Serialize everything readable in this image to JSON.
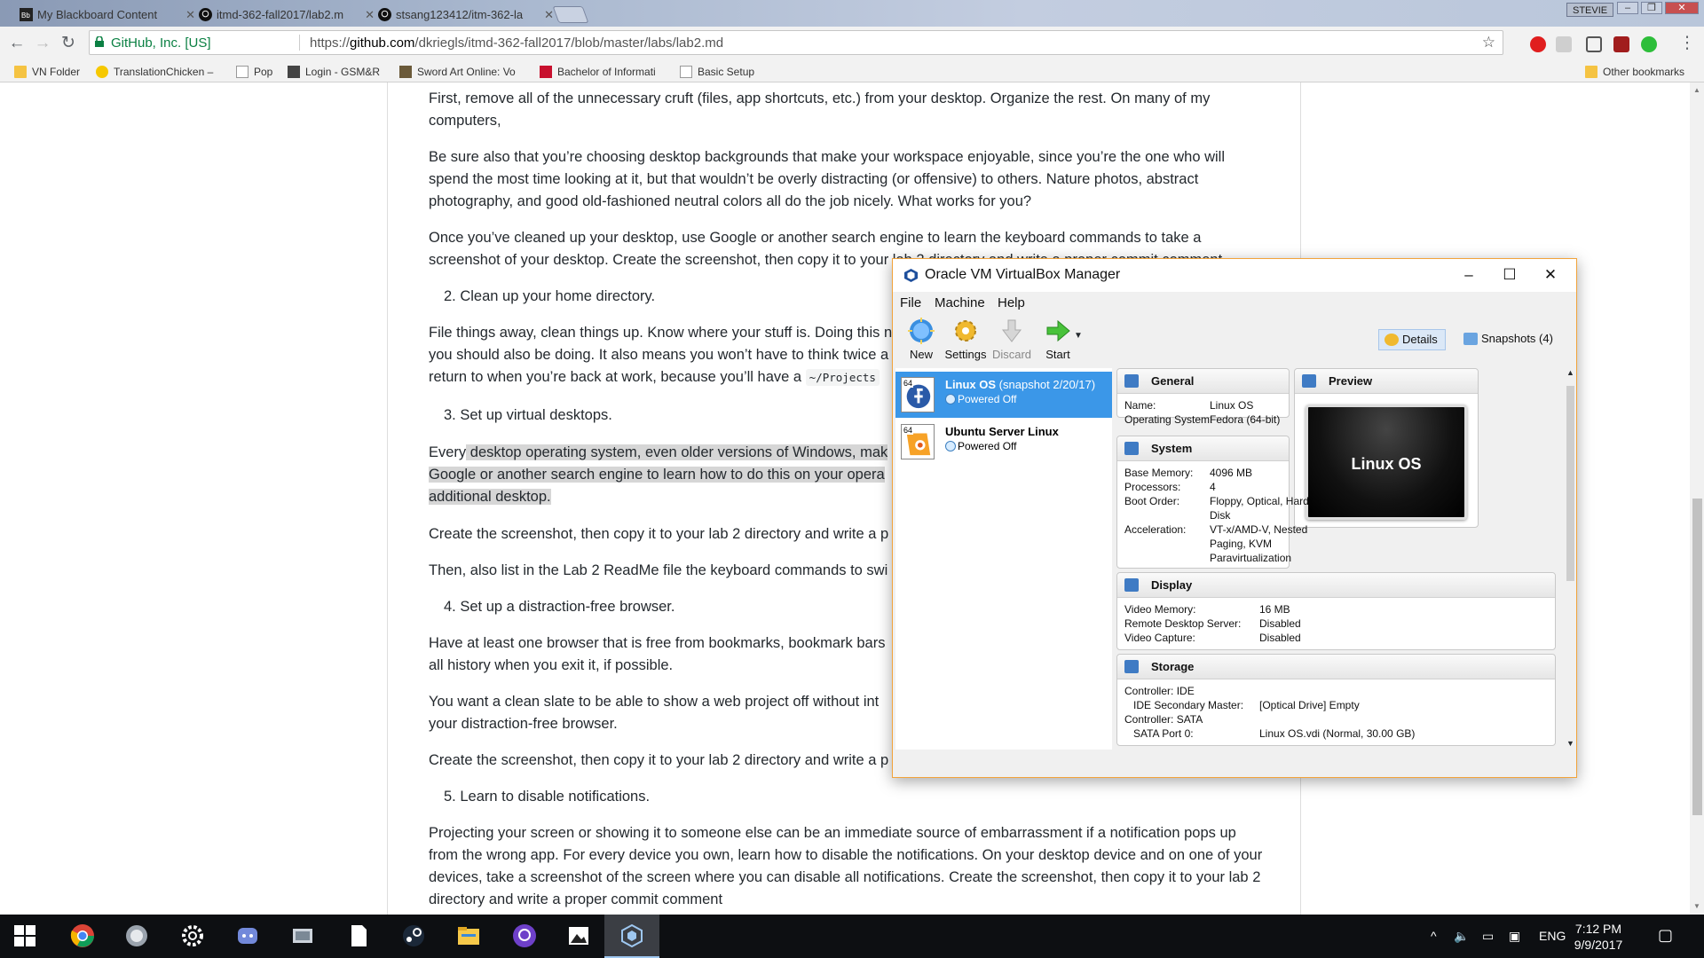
{
  "browser": {
    "tabs": [
      {
        "title": "My Blackboard Content",
        "active": false
      },
      {
        "title": "itmd-362-fall2017/lab2.m",
        "active": true
      },
      {
        "title": "stsang123412/itm-362-la",
        "active": false
      }
    ],
    "user_badge": "STEVIE",
    "site_identity": "GitHub, Inc. [US]",
    "url_prefix": "https://",
    "url_host": "github.com",
    "url_path": "/dkriegls/itmd-362-fall2017/blob/master/labs/lab2.md",
    "bookmarks": [
      {
        "label": "VN Folder",
        "icon": "folder-icon"
      },
      {
        "label": "TranslationChicken –",
        "icon": "chicken-icon"
      },
      {
        "label": "Pop",
        "icon": "page-icon"
      },
      {
        "label": "Login - GSM&R",
        "icon": "login-icon"
      },
      {
        "label": "Sword Art Online: Vo",
        "icon": "sao-icon"
      },
      {
        "label": "Bachelor of Informati",
        "icon": "iit-icon"
      },
      {
        "label": "Basic Setup",
        "icon": "page-icon"
      }
    ],
    "other_bookmarks": "Other bookmarks"
  },
  "doc": {
    "p1": "First, remove all of the unnecessary cruft (files, app shortcuts, etc.) from your desktop. Organize the rest. On many of my computers,",
    "p2": "Be sure also that you’re choosing desktop backgrounds that make your workspace enjoyable, since you’re the one who will spend the most time looking at it, but that wouldn’t be overly distracting (or offensive) to others. Nature photos, abstract photography, and good old-fashioned neutral colors all do the job nicely. What works for you?",
    "p3": "Once you’ve cleaned up your desktop, use Google or another search engine to learn the keyboard commands to take a screenshot of your desktop. Create the screenshot, then copy it to your lab 2 directory and write a proper commit comment.",
    "li2": "2. Clean up your home directory.",
    "p4a": "File things away, clean things up. Know where your stuff is. Doing this n",
    "p4b": "you should also be doing. It also means you won’t have to think twice a",
    "p4c_pre": "return to when you’re back at work, because you’ll have a",
    "p4c_code": "~/Projects",
    "li3": "3. Set up virtual desktops.",
    "p5a_pre": "Every",
    "p5a_hl": " desktop operating system, even older versions of Windows, mak",
    "p5b": "Google or another search engine to learn how to do this on your opera",
    "p5c": "additional desktop.",
    "p6": "Create the screenshot, then copy it to your lab 2 directory and write a p",
    "p7": "Then, also list in the Lab 2 ReadMe file the keyboard commands to swi",
    "li4": "4. Set up a distraction-free browser.",
    "p8a": "Have at least one browser that is free from bookmarks, bookmark bars",
    "p8b": "all history when you exit it, if possible.",
    "p9a": "You want a clean slate to be able to show a web project off without int",
    "p9b": "your distraction-free browser.",
    "p10": "Create the screenshot, then copy it to your lab 2 directory and write a p",
    "li5": "5. Learn to disable notifications.",
    "p11": "Projecting your screen or showing it to someone else can be an immediate source of embarrassment if a notification pops up from the wrong app. For every device you own, learn how to disable the notifications. On your desktop device and on one of your devices, take a screenshot of the screen where you can disable all notifications. Create the screenshot, then copy it to your lab 2 directory and write a proper commit comment"
  },
  "vbox": {
    "title": "Oracle VM VirtualBox Manager",
    "menu": [
      "File",
      "Machine",
      "Help"
    ],
    "tools": [
      {
        "label": "New",
        "icon": "new-icon",
        "enabled": true
      },
      {
        "label": "Settings",
        "icon": "settings-gear-icon",
        "enabled": true
      },
      {
        "label": "Discard",
        "icon": "discard-icon",
        "enabled": false
      },
      {
        "label": "Start",
        "icon": "start-arrow-icon",
        "enabled": true
      }
    ],
    "details_tab": "Details",
    "snapshots_tab": "Snapshots (4)",
    "vms": [
      {
        "name": "Linux OS",
        "snapshot": " (snapshot 2/20/17)",
        "state": "Powered Off",
        "bits": "64",
        "selected": true
      },
      {
        "name": "Ubuntu Server Linux",
        "snapshot": "",
        "state": "Powered Off",
        "bits": "64",
        "selected": false
      }
    ],
    "general": {
      "title": "General",
      "rows": [
        [
          "Name:",
          "Linux OS"
        ],
        [
          "Operating System:",
          "Fedora (64-bit)"
        ]
      ]
    },
    "system": {
      "title": "System",
      "rows": [
        [
          "Base Memory:",
          "4096 MB"
        ],
        [
          "Processors:",
          "4"
        ],
        [
          "Boot Order:",
          "Floppy, Optical, Hard Disk"
        ],
        [
          "Acceleration:",
          "VT-x/AMD-V, Nested Paging, KVM Paravirtualization"
        ]
      ],
      "boot_l1": "Floppy, Optical, Hard",
      "boot_l2": "Disk",
      "acc_l1": "VT-x/AMD-V, Nested",
      "acc_l2": "Paging, KVM",
      "acc_l3": "Paravirtualization"
    },
    "preview": {
      "title": "Preview",
      "screen_text": "Linux OS"
    },
    "display": {
      "title": "Display",
      "rows": [
        [
          "Video Memory:",
          "16 MB"
        ],
        [
          "Remote Desktop Server:",
          "Disabled"
        ],
        [
          "Video Capture:",
          "Disabled"
        ]
      ]
    },
    "storage": {
      "title": "Storage",
      "rows": [
        [
          "Controller: IDE",
          ""
        ],
        [
          "IDE Secondary Master:",
          "[Optical Drive] Empty"
        ],
        [
          "Controller: SATA",
          ""
        ],
        [
          "SATA Port 0:",
          "Linux OS.vdi (Normal, 30.00 GB)"
        ]
      ]
    }
  },
  "taskbar": {
    "apps": [
      "windows-start-icon",
      "chrome-icon",
      "snip-icon",
      "settings-icon",
      "discord-icon",
      "file-manager-icon",
      "notepad-icon",
      "steam-icon",
      "file-explorer-icon",
      "github-icon",
      "photos-icon",
      "virtualbox-icon"
    ],
    "lang": "ENG",
    "time": "7:12 PM",
    "date": "9/9/2017"
  },
  "colors": {
    "accent_blue": "#3b97e8",
    "vbox_border": "#f2a33a",
    "secure_green": "#0b8043",
    "taskbar": "#0d0f12"
  }
}
